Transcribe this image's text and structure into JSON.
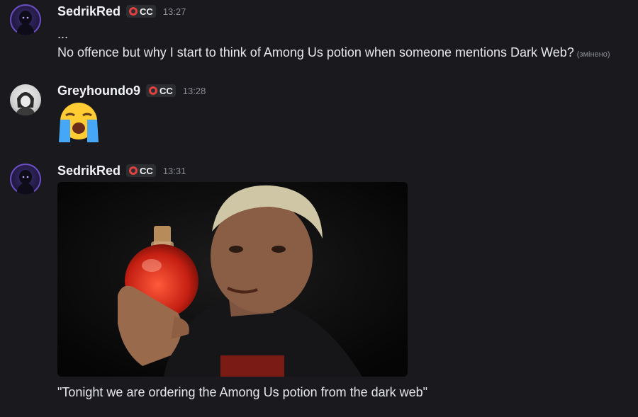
{
  "messages": [
    {
      "username": "SedrikRed",
      "tag": "CC",
      "time": "13:27",
      "lines": [
        "...",
        "No offence but why I start to think of Among Us potion when someone mentions Dark Web?"
      ],
      "edited": "(змінено)"
    },
    {
      "username": "Greyhoundo9",
      "tag": "CC",
      "time": "13:28",
      "emoji": "loudly-crying-face"
    },
    {
      "username": "SedrikRed",
      "tag": "CC",
      "time": "13:31",
      "caption": "\"Tonight we are ordering the Among Us potion from the dark web\""
    }
  ],
  "colors": {
    "background": "#1a1a1e",
    "tag_icon": "#e0413f",
    "username": "#f2f3f5",
    "timestamp": "#8b8e94"
  }
}
